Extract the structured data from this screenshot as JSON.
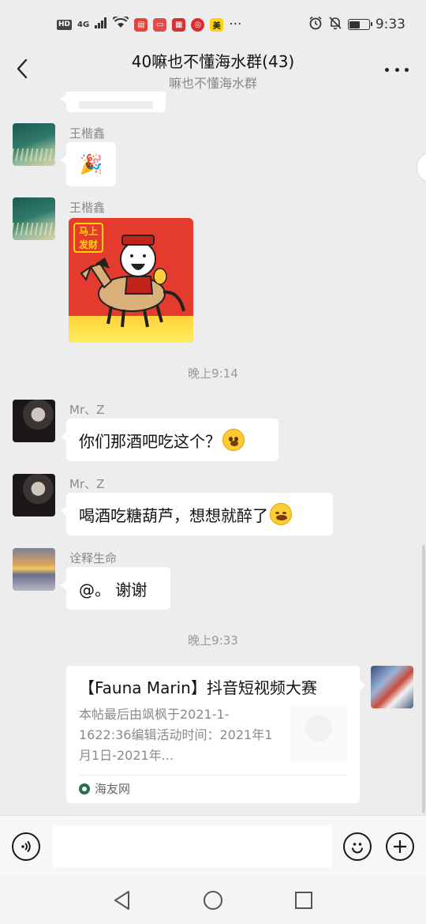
{
  "status_bar": {
    "left_badges": [
      "HD",
      "4G"
    ],
    "app_icon_labels": [
      "美"
    ],
    "more": "···",
    "time": "9:33"
  },
  "header": {
    "title": "40嘛也不懂海水群(43)",
    "subtitle": "嘛也不懂海水群"
  },
  "messages": [
    {
      "sender": "王楷鑫",
      "content": "🎉",
      "type": "emoji"
    },
    {
      "sender": "王楷鑫",
      "type": "sticker",
      "sticker_text": "马上\n发财"
    },
    {
      "time": "晚上9:14"
    },
    {
      "sender": "Mr、Z",
      "text": "你们那酒吧吃这个？"
    },
    {
      "sender": "Mr、Z",
      "text": "喝酒吃糖葫芦，想想就醉了"
    },
    {
      "sender": "诠释生命",
      "text": "@。 谢谢"
    },
    {
      "time": "晚上9:33"
    }
  ],
  "link_card": {
    "title": "【Fauna Marin】抖音短视频大赛",
    "description": "本帖最后由飒枫于2021-1-1622:36编辑活动时间：2021年1月1日-2021年...",
    "source": "海友网"
  },
  "input": {
    "value": "",
    "placeholder": ""
  },
  "colors": {
    "background": "#ededed",
    "bubble": "#ffffff",
    "sticker_red": "#e53a2e"
  }
}
